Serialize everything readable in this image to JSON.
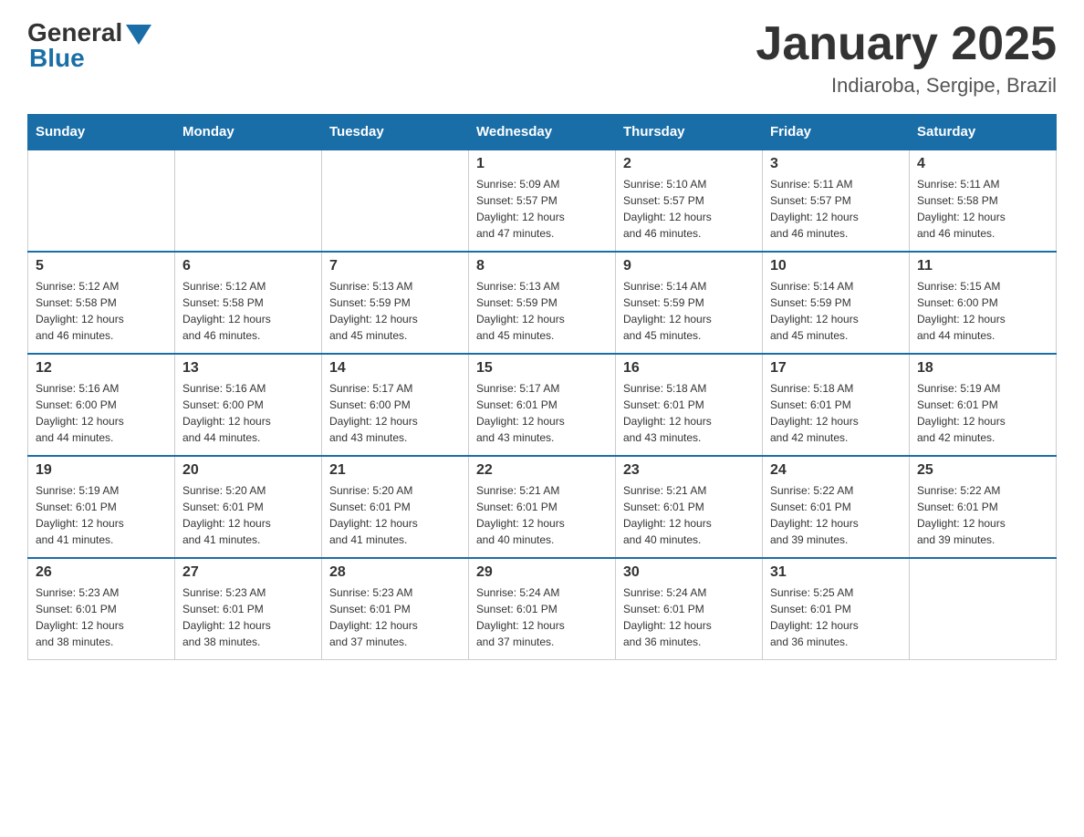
{
  "header": {
    "logo_general": "General",
    "logo_blue": "Blue",
    "month_title": "January 2025",
    "subtitle": "Indiaroba, Sergipe, Brazil"
  },
  "days_of_week": [
    "Sunday",
    "Monday",
    "Tuesday",
    "Wednesday",
    "Thursday",
    "Friday",
    "Saturday"
  ],
  "weeks": [
    [
      {
        "day": "",
        "info": ""
      },
      {
        "day": "",
        "info": ""
      },
      {
        "day": "",
        "info": ""
      },
      {
        "day": "1",
        "info": "Sunrise: 5:09 AM\nSunset: 5:57 PM\nDaylight: 12 hours\nand 47 minutes."
      },
      {
        "day": "2",
        "info": "Sunrise: 5:10 AM\nSunset: 5:57 PM\nDaylight: 12 hours\nand 46 minutes."
      },
      {
        "day": "3",
        "info": "Sunrise: 5:11 AM\nSunset: 5:57 PM\nDaylight: 12 hours\nand 46 minutes."
      },
      {
        "day": "4",
        "info": "Sunrise: 5:11 AM\nSunset: 5:58 PM\nDaylight: 12 hours\nand 46 minutes."
      }
    ],
    [
      {
        "day": "5",
        "info": "Sunrise: 5:12 AM\nSunset: 5:58 PM\nDaylight: 12 hours\nand 46 minutes."
      },
      {
        "day": "6",
        "info": "Sunrise: 5:12 AM\nSunset: 5:58 PM\nDaylight: 12 hours\nand 46 minutes."
      },
      {
        "day": "7",
        "info": "Sunrise: 5:13 AM\nSunset: 5:59 PM\nDaylight: 12 hours\nand 45 minutes."
      },
      {
        "day": "8",
        "info": "Sunrise: 5:13 AM\nSunset: 5:59 PM\nDaylight: 12 hours\nand 45 minutes."
      },
      {
        "day": "9",
        "info": "Sunrise: 5:14 AM\nSunset: 5:59 PM\nDaylight: 12 hours\nand 45 minutes."
      },
      {
        "day": "10",
        "info": "Sunrise: 5:14 AM\nSunset: 5:59 PM\nDaylight: 12 hours\nand 45 minutes."
      },
      {
        "day": "11",
        "info": "Sunrise: 5:15 AM\nSunset: 6:00 PM\nDaylight: 12 hours\nand 44 minutes."
      }
    ],
    [
      {
        "day": "12",
        "info": "Sunrise: 5:16 AM\nSunset: 6:00 PM\nDaylight: 12 hours\nand 44 minutes."
      },
      {
        "day": "13",
        "info": "Sunrise: 5:16 AM\nSunset: 6:00 PM\nDaylight: 12 hours\nand 44 minutes."
      },
      {
        "day": "14",
        "info": "Sunrise: 5:17 AM\nSunset: 6:00 PM\nDaylight: 12 hours\nand 43 minutes."
      },
      {
        "day": "15",
        "info": "Sunrise: 5:17 AM\nSunset: 6:01 PM\nDaylight: 12 hours\nand 43 minutes."
      },
      {
        "day": "16",
        "info": "Sunrise: 5:18 AM\nSunset: 6:01 PM\nDaylight: 12 hours\nand 43 minutes."
      },
      {
        "day": "17",
        "info": "Sunrise: 5:18 AM\nSunset: 6:01 PM\nDaylight: 12 hours\nand 42 minutes."
      },
      {
        "day": "18",
        "info": "Sunrise: 5:19 AM\nSunset: 6:01 PM\nDaylight: 12 hours\nand 42 minutes."
      }
    ],
    [
      {
        "day": "19",
        "info": "Sunrise: 5:19 AM\nSunset: 6:01 PM\nDaylight: 12 hours\nand 41 minutes."
      },
      {
        "day": "20",
        "info": "Sunrise: 5:20 AM\nSunset: 6:01 PM\nDaylight: 12 hours\nand 41 minutes."
      },
      {
        "day": "21",
        "info": "Sunrise: 5:20 AM\nSunset: 6:01 PM\nDaylight: 12 hours\nand 41 minutes."
      },
      {
        "day": "22",
        "info": "Sunrise: 5:21 AM\nSunset: 6:01 PM\nDaylight: 12 hours\nand 40 minutes."
      },
      {
        "day": "23",
        "info": "Sunrise: 5:21 AM\nSunset: 6:01 PM\nDaylight: 12 hours\nand 40 minutes."
      },
      {
        "day": "24",
        "info": "Sunrise: 5:22 AM\nSunset: 6:01 PM\nDaylight: 12 hours\nand 39 minutes."
      },
      {
        "day": "25",
        "info": "Sunrise: 5:22 AM\nSunset: 6:01 PM\nDaylight: 12 hours\nand 39 minutes."
      }
    ],
    [
      {
        "day": "26",
        "info": "Sunrise: 5:23 AM\nSunset: 6:01 PM\nDaylight: 12 hours\nand 38 minutes."
      },
      {
        "day": "27",
        "info": "Sunrise: 5:23 AM\nSunset: 6:01 PM\nDaylight: 12 hours\nand 38 minutes."
      },
      {
        "day": "28",
        "info": "Sunrise: 5:23 AM\nSunset: 6:01 PM\nDaylight: 12 hours\nand 37 minutes."
      },
      {
        "day": "29",
        "info": "Sunrise: 5:24 AM\nSunset: 6:01 PM\nDaylight: 12 hours\nand 37 minutes."
      },
      {
        "day": "30",
        "info": "Sunrise: 5:24 AM\nSunset: 6:01 PM\nDaylight: 12 hours\nand 36 minutes."
      },
      {
        "day": "31",
        "info": "Sunrise: 5:25 AM\nSunset: 6:01 PM\nDaylight: 12 hours\nand 36 minutes."
      },
      {
        "day": "",
        "info": ""
      }
    ]
  ]
}
